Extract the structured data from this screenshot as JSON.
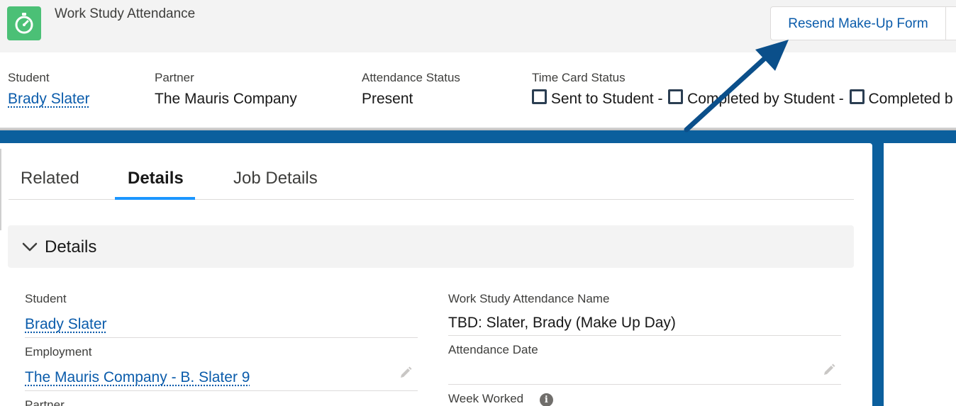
{
  "header": {
    "app_title": "Work Study Attendance",
    "app_icon": "stopwatch-icon",
    "action_button_label": "Resend Make-Up Form"
  },
  "highlights": {
    "student": {
      "label": "Student",
      "value": "Brady Slater"
    },
    "partner": {
      "label": "Partner",
      "value": "The Mauris Company"
    },
    "attendance_status": {
      "label": "Attendance Status",
      "value": "Present"
    },
    "time_card_status": {
      "label": "Time Card Status",
      "items": [
        "Sent to Student -",
        "Completed by Student -",
        "Completed b"
      ]
    }
  },
  "tabs": [
    {
      "label": "Related",
      "active": false
    },
    {
      "label": "Details",
      "active": true
    },
    {
      "label": "Job Details",
      "active": false
    }
  ],
  "section": {
    "title": "Details",
    "expanded": true
  },
  "fields": {
    "student": {
      "label": "Student",
      "value": "Brady Slater"
    },
    "employment": {
      "label": "Employment",
      "value": "The Mauris Company - B. Slater 9"
    },
    "partner": {
      "label": "Partner"
    },
    "attendance_name": {
      "label": "Work Study Attendance Name",
      "value": "TBD: Slater, Brady (Make Up Day)"
    },
    "attendance_date": {
      "label": "Attendance Date",
      "value": ""
    },
    "week_worked": {
      "label": "Week Worked",
      "info_icon": "i"
    }
  },
  "colors": {
    "brand_blue": "#0b5f9d",
    "link": "#0b5cab",
    "app_icon_green": "#4bc076",
    "arrow": "#0b4f8a"
  }
}
